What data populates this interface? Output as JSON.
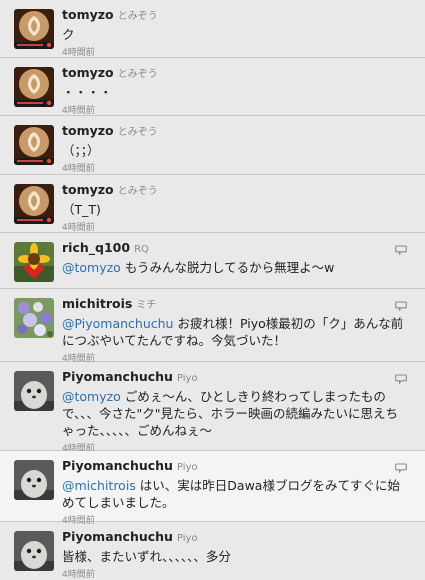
{
  "tweets": [
    {
      "screen_name": "tomyzo",
      "display_name": "とみぞう",
      "mention": "",
      "text": "ク",
      "time": "4時間前",
      "avatar": "latte-art"
    },
    {
      "screen_name": "tomyzo",
      "display_name": "とみぞう",
      "mention": "",
      "text": "・・・・",
      "time": "4時間前",
      "avatar": "latte-art"
    },
    {
      "screen_name": "tomyzo",
      "display_name": "とみぞう",
      "mention": "",
      "text": "（；；）",
      "time": "4時間前",
      "avatar": "latte-art"
    },
    {
      "screen_name": "tomyzo",
      "display_name": "とみぞう",
      "mention": "",
      "text": "（T_T)",
      "time": "4時間前",
      "avatar": "latte-art"
    },
    {
      "screen_name": "rich_q100",
      "display_name": "RQ",
      "mention": "@tomyzo",
      "text": " もうみんな脱力してるから無理よ〜w",
      "time": "",
      "avatar": "sunflower-heart"
    },
    {
      "screen_name": "michitrois",
      "display_name": "ミチ",
      "mention": "@Piyomanchuchu",
      "text": " お疲れ様！Piyo様最初の「ク」あんな前につぶやいてたんですね。今気づいた！",
      "time": "4時間前",
      "avatar": "flowers"
    },
    {
      "screen_name": "Piyomanchuchu",
      "display_name": "Piyo",
      "mention": "@tomyzo",
      "text": " ごめぇ〜ん、ひとしきり終わってしまったもので、、、今さた\"ク\"見たら、ホラー映画の続編みたいに思えちゃった、、、、、ごめんねぇ〜",
      "time": "4時間前",
      "avatar": "seal-pup"
    },
    {
      "screen_name": "Piyomanchuchu",
      "display_name": "Piyo",
      "mention": "@michitrois",
      "text": " はい、実は昨日Dawa様ブログをみてすぐに始めてしまいました。",
      "time": "4時間前",
      "avatar": "seal-pup"
    },
    {
      "screen_name": "Piyomanchuchu",
      "display_name": "Piyo",
      "mention": "",
      "text": "皆様、またいずれ、、、、、、多分",
      "time": "4時間前",
      "avatar": "seal-pup"
    }
  ],
  "colors": {
    "mention": "#2b6fb6",
    "background": "#e9e9e9",
    "meta": "#8a8a8a"
  }
}
